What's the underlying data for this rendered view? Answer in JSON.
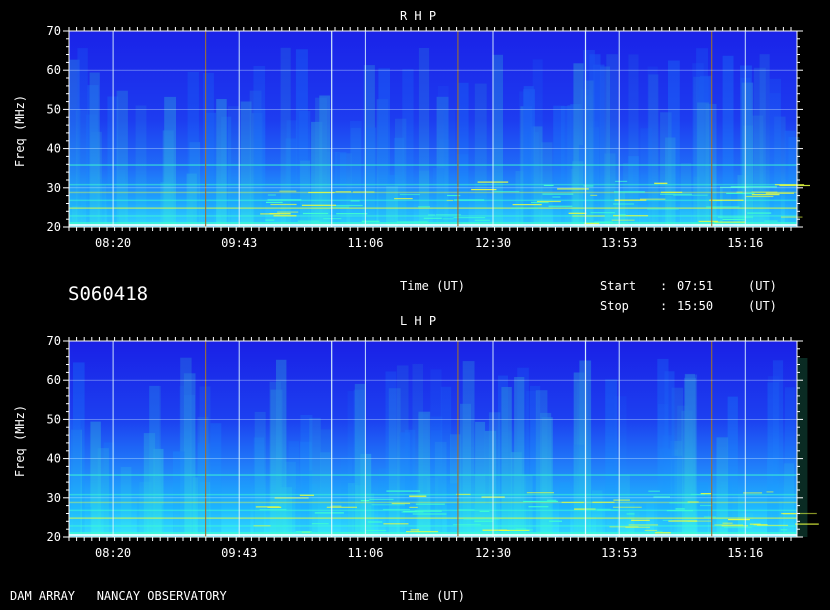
{
  "header": {
    "date_code": "S060418",
    "time_label": "Time (UT)",
    "start_label": "Start",
    "start_sep": ":",
    "start_time": "07:51",
    "start_unit": "(UT)",
    "stop_label": "Stop",
    "stop_sep": ":",
    "stop_time": "15:50",
    "stop_unit": "(UT)"
  },
  "footer": {
    "observatory": "DAM ARRAY   NANCAY OBSERVATORY",
    "time_label": "Time (UT)"
  },
  "colors": {
    "background": "#000000",
    "spectrum_low": "#1a2cf0",
    "spectrum_mid": "#1aa0ff",
    "spectrum_high": "#40ffd0",
    "burst": "#e8ff40",
    "gridline": "#e8ffff",
    "marker": "#a07030"
  },
  "chart_data": [
    {
      "type": "heatmap",
      "title": "R H P",
      "ylabel": "Freq (MHz)",
      "xlabel": "Time (UT)",
      "ylim": [
        20,
        70
      ],
      "yticks": [
        "20",
        "30",
        "40",
        "50",
        "60",
        "70"
      ],
      "xticks": [
        "08:20",
        "09:43",
        "11:06",
        "12:30",
        "13:53",
        "15:16"
      ],
      "xlim": [
        "07:51",
        "15:50"
      ],
      "grid": true
    },
    {
      "type": "heatmap",
      "title": "L H P",
      "ylabel": "Freq (MHz)",
      "xlabel": "Time (UT)",
      "ylim": [
        20,
        70
      ],
      "yticks": [
        "20",
        "30",
        "40",
        "50",
        "60",
        "70"
      ],
      "xticks": [
        "08:20",
        "09:43",
        "11:06",
        "12:30",
        "13:53",
        "15:16"
      ],
      "xlim": [
        "07:51",
        "15:50"
      ],
      "grid": true
    }
  ]
}
